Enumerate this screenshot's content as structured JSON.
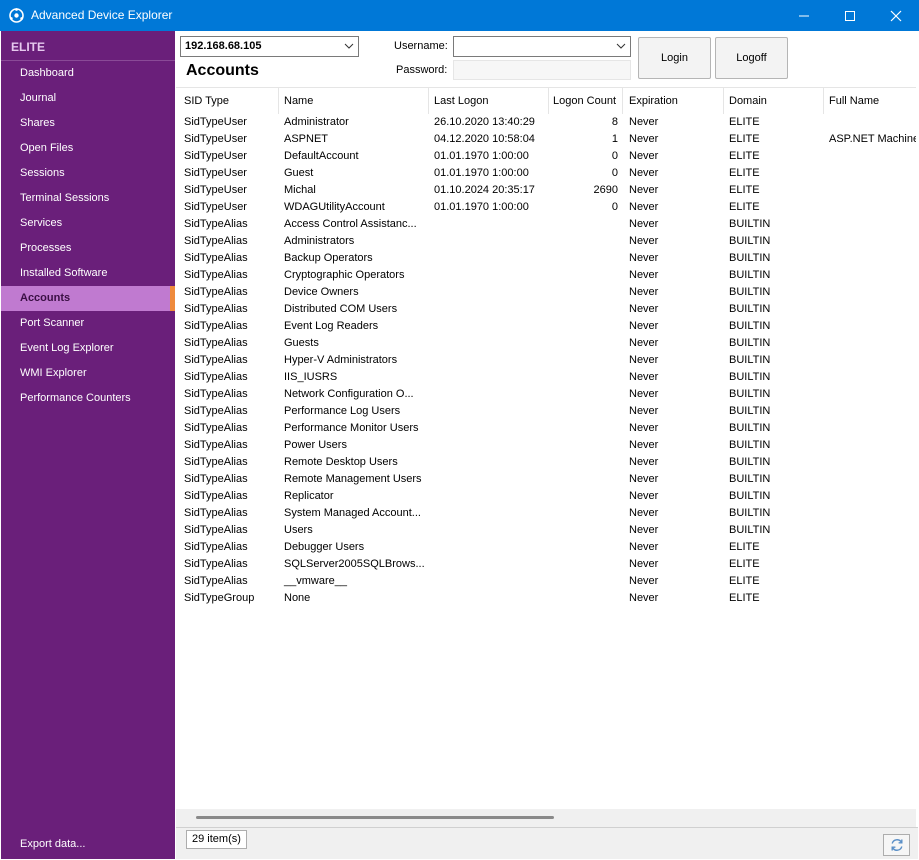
{
  "window": {
    "title": "Advanced Device Explorer"
  },
  "sidebar": {
    "header": "ELITE",
    "items": [
      {
        "label": "Dashboard"
      },
      {
        "label": "Journal"
      },
      {
        "label": "Shares"
      },
      {
        "label": "Open Files"
      },
      {
        "label": "Sessions"
      },
      {
        "label": "Terminal Sessions"
      },
      {
        "label": "Services"
      },
      {
        "label": "Processes"
      },
      {
        "label": "Installed Software"
      },
      {
        "label": "Accounts"
      },
      {
        "label": "Port Scanner"
      },
      {
        "label": "Event Log Explorer"
      },
      {
        "label": "WMI Explorer"
      },
      {
        "label": "Performance Counters"
      }
    ],
    "active": "Accounts",
    "export_label": "Export data..."
  },
  "host": {
    "value": "192.168.68.105"
  },
  "page_title": "Accounts",
  "login": {
    "username_label": "Username:",
    "password_label": "Password:",
    "username_value": "",
    "password_value": "",
    "login_button": "Login",
    "logoff_button": "Logoff"
  },
  "table": {
    "columns": [
      "SID Type",
      "Name",
      "Last Logon",
      "Logon Count",
      "Expiration",
      "Domain",
      "Full Name"
    ],
    "rows": [
      [
        "SidTypeUser",
        "Administrator",
        "26.10.2020 13:40:29",
        "8",
        "Never",
        "ELITE",
        ""
      ],
      [
        "SidTypeUser",
        "ASPNET",
        "04.12.2020 10:58:04",
        "1",
        "Never",
        "ELITE",
        "ASP.NET Machine"
      ],
      [
        "SidTypeUser",
        "DefaultAccount",
        "01.01.1970 1:00:00",
        "0",
        "Never",
        "ELITE",
        ""
      ],
      [
        "SidTypeUser",
        "Guest",
        "01.01.1970 1:00:00",
        "0",
        "Never",
        "ELITE",
        ""
      ],
      [
        "SidTypeUser",
        "Michal",
        "01.10.2024 20:35:17",
        "2690",
        "Never",
        "ELITE",
        ""
      ],
      [
        "SidTypeUser",
        "WDAGUtilityAccount",
        "01.01.1970 1:00:00",
        "0",
        "Never",
        "ELITE",
        ""
      ],
      [
        "SidTypeAlias",
        "Access Control Assistanc...",
        "",
        "",
        "Never",
        "BUILTIN",
        ""
      ],
      [
        "SidTypeAlias",
        "Administrators",
        "",
        "",
        "Never",
        "BUILTIN",
        ""
      ],
      [
        "SidTypeAlias",
        "Backup Operators",
        "",
        "",
        "Never",
        "BUILTIN",
        ""
      ],
      [
        "SidTypeAlias",
        "Cryptographic Operators",
        "",
        "",
        "Never",
        "BUILTIN",
        ""
      ],
      [
        "SidTypeAlias",
        "Device Owners",
        "",
        "",
        "Never",
        "BUILTIN",
        ""
      ],
      [
        "SidTypeAlias",
        "Distributed COM Users",
        "",
        "",
        "Never",
        "BUILTIN",
        ""
      ],
      [
        "SidTypeAlias",
        "Event Log Readers",
        "",
        "",
        "Never",
        "BUILTIN",
        ""
      ],
      [
        "SidTypeAlias",
        "Guests",
        "",
        "",
        "Never",
        "BUILTIN",
        ""
      ],
      [
        "SidTypeAlias",
        "Hyper-V Administrators",
        "",
        "",
        "Never",
        "BUILTIN",
        ""
      ],
      [
        "SidTypeAlias",
        "IIS_IUSRS",
        "",
        "",
        "Never",
        "BUILTIN",
        ""
      ],
      [
        "SidTypeAlias",
        "Network Configuration O...",
        "",
        "",
        "Never",
        "BUILTIN",
        ""
      ],
      [
        "SidTypeAlias",
        "Performance Log Users",
        "",
        "",
        "Never",
        "BUILTIN",
        ""
      ],
      [
        "SidTypeAlias",
        "Performance Monitor Users",
        "",
        "",
        "Never",
        "BUILTIN",
        ""
      ],
      [
        "SidTypeAlias",
        "Power Users",
        "",
        "",
        "Never",
        "BUILTIN",
        ""
      ],
      [
        "SidTypeAlias",
        "Remote Desktop Users",
        "",
        "",
        "Never",
        "BUILTIN",
        ""
      ],
      [
        "SidTypeAlias",
        "Remote Management Users",
        "",
        "",
        "Never",
        "BUILTIN",
        ""
      ],
      [
        "SidTypeAlias",
        "Replicator",
        "",
        "",
        "Never",
        "BUILTIN",
        ""
      ],
      [
        "SidTypeAlias",
        "System Managed Account...",
        "",
        "",
        "Never",
        "BUILTIN",
        ""
      ],
      [
        "SidTypeAlias",
        "Users",
        "",
        "",
        "Never",
        "BUILTIN",
        ""
      ],
      [
        "SidTypeAlias",
        "Debugger Users",
        "",
        "",
        "Never",
        "ELITE",
        ""
      ],
      [
        "SidTypeAlias",
        "SQLServer2005SQLBrows...",
        "",
        "",
        "Never",
        "ELITE",
        ""
      ],
      [
        "SidTypeAlias",
        "__vmware__",
        "",
        "",
        "Never",
        "ELITE",
        ""
      ],
      [
        "SidTypeGroup",
        "None",
        "",
        "",
        "Never",
        "ELITE",
        ""
      ]
    ]
  },
  "status": {
    "count_label": "29 item(s)"
  },
  "colors": {
    "titlebar": "#0078d7",
    "sidebar": "#6a1f7a",
    "sidebar_active": "#c07ad0",
    "active_marker": "#ee8a3c"
  }
}
